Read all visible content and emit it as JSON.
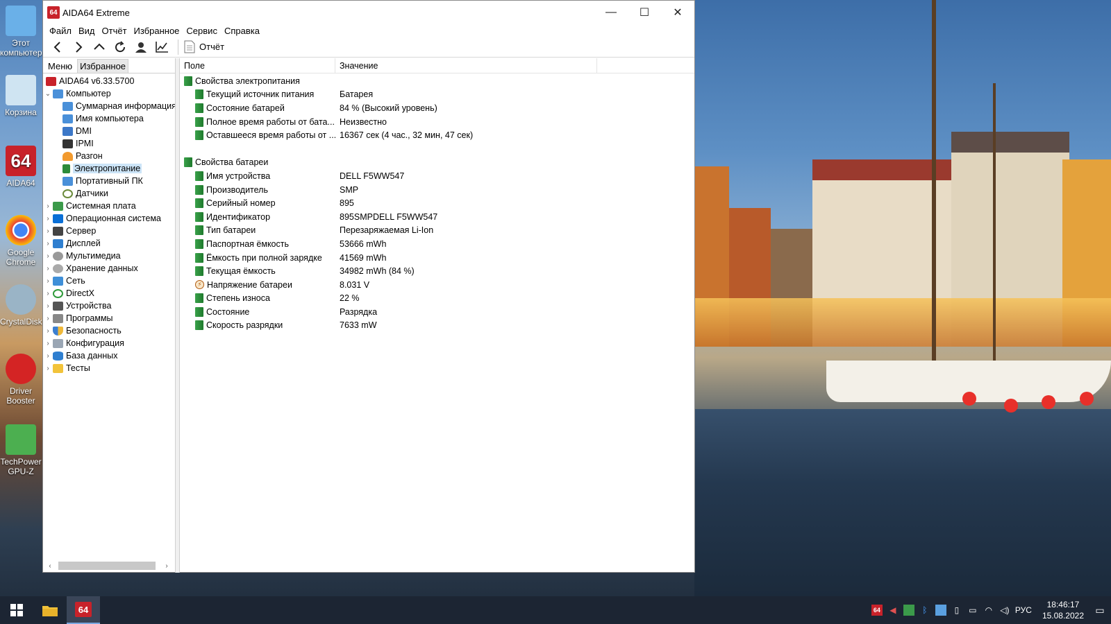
{
  "window": {
    "title": "AIDA64 Extreme",
    "logo": "64",
    "minimize_glyph": "—",
    "maximize_glyph": "☐",
    "close_glyph": "✕"
  },
  "menu": [
    "Файл",
    "Вид",
    "Отчёт",
    "Избранное",
    "Сервис",
    "Справка"
  ],
  "toolbar": {
    "report_label": "Отчёт",
    "icons": [
      "back-icon",
      "forward-icon",
      "up-icon",
      "refresh-icon",
      "user-icon",
      "chart-icon",
      "report-icon"
    ]
  },
  "left_tabs": {
    "menu": "Меню",
    "favorites": "Избранное"
  },
  "tree": {
    "root": "AIDA64 v6.33.5700",
    "computer": "Компьютер",
    "computer_children": [
      "Суммарная информация",
      "Имя компьютера",
      "DMI",
      "IPMI",
      "Разгон",
      "Электропитание",
      "Портативный ПК",
      "Датчики"
    ],
    "selected": "Электропитание",
    "top_level": [
      "Системная плата",
      "Операционная система",
      "Сервер",
      "Дисплей",
      "Мультимедиа",
      "Хранение данных",
      "Сеть",
      "DirectX",
      "Устройства",
      "Программы",
      "Безопасность",
      "Конфигурация",
      "База данных",
      "Тесты"
    ]
  },
  "columns": {
    "field": "Поле",
    "value": "Значение"
  },
  "power": {
    "group": "Свойства электропитания",
    "rows": [
      {
        "field": "Текущий источник питания",
        "value": "Батарея"
      },
      {
        "field": "Состояние батарей",
        "value": "84 % (Высокий уровень)"
      },
      {
        "field": "Полное время работы от бата...",
        "value": "Неизвестно"
      },
      {
        "field": "Оставшееся время работы от ...",
        "value": "16367 сек (4 час., 32 мин, 47 сек)"
      }
    ]
  },
  "battery": {
    "group": "Свойства батареи",
    "rows": [
      {
        "field": "Имя устройства",
        "value": "DELL F5WW547"
      },
      {
        "field": "Производитель",
        "value": "SMP"
      },
      {
        "field": "Серийный номер",
        "value": "895"
      },
      {
        "field": "Идентификатор",
        "value": "895SMPDELL F5WW547"
      },
      {
        "field": "Тип батареи",
        "value": "Перезаряжаемая Li-Ion"
      },
      {
        "field": "Паспортная ёмкость",
        "value": "53666 mWh"
      },
      {
        "field": "Ёмкость при полной зарядке",
        "value": "41569 mWh"
      },
      {
        "field": "Текущая ёмкость",
        "value": "34982 mWh  (84 %)"
      },
      {
        "field": "Напряжение батареи",
        "value": "8.031 V"
      },
      {
        "field": "Степень износа",
        "value": "22 %"
      },
      {
        "field": "Состояние",
        "value": "Разрядка"
      },
      {
        "field": "Скорость разрядки",
        "value": "7633 mW"
      }
    ]
  },
  "desktop_icons": [
    {
      "label": "Этот компьютер"
    },
    {
      "label": "Корзина"
    },
    {
      "label": "AIDA64"
    },
    {
      "label": "Google Chrome"
    },
    {
      "label": "CrystalDisk"
    },
    {
      "label": "Driver Booster"
    },
    {
      "label": "TechPower GPU-Z"
    }
  ],
  "taskbar": {
    "lang": "РУС",
    "time": "18:46:17",
    "date": "15.08.2022",
    "aida_label": "64"
  },
  "colors": {
    "selection": "#cce4f7",
    "battery_green": "#2c8b3a",
    "aida_red": "#c8222a",
    "taskbar": "#1c2533"
  }
}
